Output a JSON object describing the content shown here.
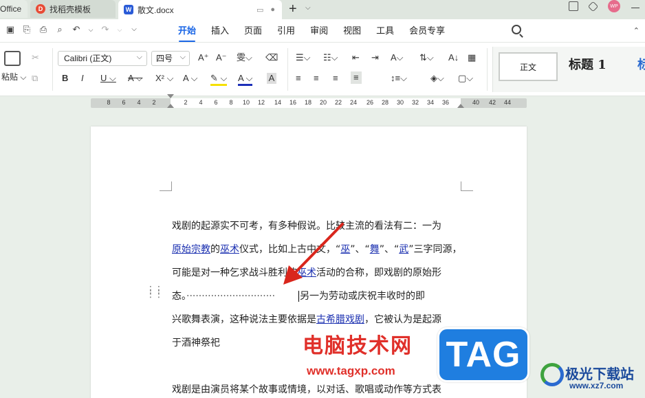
{
  "tabs": [
    {
      "label": "Office"
    },
    {
      "label": "找稻壳模板"
    },
    {
      "label": "散文.docx"
    }
  ],
  "menu": [
    "开始",
    "插入",
    "页面",
    "引用",
    "审阅",
    "视图",
    "工具",
    "会员专享"
  ],
  "toolbar": {
    "paste_label": "粘贴",
    "font_name": "Calibri (正文)",
    "font_size": "四号",
    "styles": [
      "正文",
      "标题 1",
      "标"
    ]
  },
  "ruler": {
    "numbers": [
      "8",
      "6",
      "4",
      "2",
      "2",
      "4",
      "6",
      "8",
      "10",
      "12",
      "14",
      "16",
      "18",
      "20",
      "22",
      "24",
      "26",
      "28",
      "30",
      "32",
      "34",
      "36",
      "40",
      "42",
      "44"
    ]
  },
  "document": {
    "p1": {
      "l1": "戏剧的起源实不可考，有多种假说。比较主流的看法有二：一为",
      "l2a": "原始宗教",
      "l2b": "的",
      "l2c": "巫术",
      "l2d": "仪式，比如上古中文，“",
      "l2e": "巫",
      "l2f": "”、“",
      "l2g": "舞",
      "l2h": "”、“",
      "l2i": "武",
      "l2j": "”三字同源，",
      "l3a": "可能是对一种乞求战斗胜利的",
      "l3b": "巫术",
      "l3c": "活动的合称，即戏剧的原始形",
      "l4a": "态。",
      "l4b": "·····························",
      "l4c": "另一为劳动或庆祝丰收时的即",
      "l5a": "兴歌舞表演，这种说法主要依据是",
      "l5b": "古希腊戏剧",
      "l5c": "，它被认为是起源",
      "l6": "于酒神祭祀"
    },
    "p2": "戏剧是由演员将某个故事或情境，以对话、歌唱或动作等方式表"
  },
  "watermark": {
    "site_cn": "电脑技术网",
    "site_url": "www.tagxp.com",
    "tag": "TAG",
    "brand_cn": "极光下载站",
    "brand_url": "www.xz7.com"
  },
  "colors": {
    "accent": "#1a66e6",
    "link": "#1a2fb0",
    "arrow": "#d9261c"
  }
}
